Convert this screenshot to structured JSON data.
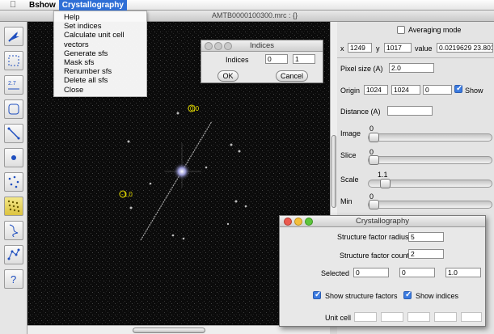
{
  "menubar": {
    "app_name": "Bshow",
    "active_menu": "Crystallography"
  },
  "dropdown": {
    "items": [
      "Help",
      "Set indices",
      "Calculate unit cell vectors",
      "Generate sfs",
      "Mask sfs",
      "Renumber sfs",
      "Delete all sfs",
      "Close"
    ]
  },
  "main_window": {
    "title": "AMTB0000100300.mrc : {}"
  },
  "image": {
    "annotations": [
      {
        "label": "0,0"
      },
      {
        "label": "-1,0"
      }
    ]
  },
  "right_panel": {
    "averaging_mode": {
      "label": "Averaging mode",
      "checked": false
    },
    "x_label": "x",
    "x_value": "1249",
    "y_label": "y",
    "y_value": "1017",
    "value_label": "value",
    "value_value": "0.0219629 23.8011",
    "pixel_size_label": "Pixel size (A)",
    "pixel_size_value": "2.0",
    "origin_label": "Origin",
    "origin_x": "1024",
    "origin_y": "1024",
    "origin_z": "0",
    "show_label": "Show",
    "show_checked": true,
    "distance_label": "Distance (A)",
    "distance_value": "",
    "image_label": "Image",
    "image_value": "0",
    "slice_label": "Slice",
    "slice_value": "0",
    "scale_label": "Scale",
    "scale_value": "1.1",
    "min_label": "Min",
    "min_value": "0"
  },
  "indices_dialog": {
    "title": "Indices",
    "label": "Indices",
    "h": "0",
    "k": "1",
    "ok": "OK",
    "cancel": "Cancel"
  },
  "cryst_dialog": {
    "title": "Crystallography",
    "radius_label": "Structure factor radius",
    "radius_value": "5",
    "count_label": "Structure factor count",
    "count_value": "2",
    "selected_label": "Selected",
    "selected_1": "0",
    "selected_2": "0",
    "selected_3": "1.0",
    "show_sfs_label": "Show structure factors",
    "show_sfs_checked": true,
    "show_indices_label": "Show indices",
    "show_indices_checked": true,
    "unit_cell_label": "Unit cell"
  },
  "colors": {
    "menu_highlight": "#2f6fd6",
    "checkbox_on": "#3c7be0",
    "annotation": "#e8e000"
  }
}
